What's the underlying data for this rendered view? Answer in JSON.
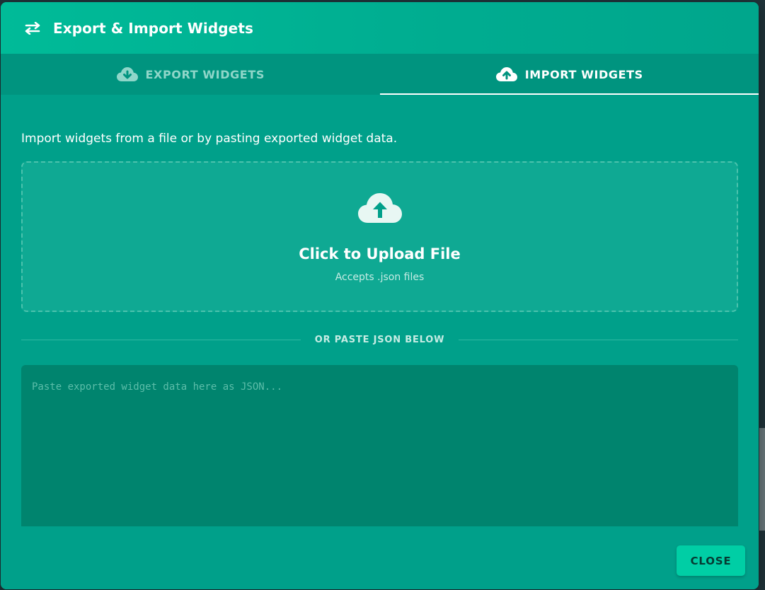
{
  "dialog": {
    "title": "Export & Import Widgets",
    "header_icon": "swap-arrows-icon"
  },
  "tabs": [
    {
      "label": "EXPORT WIDGETS",
      "icon": "cloud-download-icon",
      "active": false
    },
    {
      "label": "IMPORT WIDGETS",
      "icon": "cloud-upload-icon",
      "active": true
    }
  ],
  "import": {
    "intro": "Import widgets from a file or by pasting exported widget data.",
    "upload_title": "Click to Upload File",
    "upload_subtitle": "Accepts .json files",
    "divider_text": "OR PASTE JSON BELOW",
    "paste_placeholder": "Paste exported widget data here as JSON...",
    "paste_value": ""
  },
  "footer": {
    "close_label": "CLOSE"
  },
  "colors": {
    "dialog_bg": "#00a08a",
    "header_bg": "#00bb98",
    "tab_bar_bg": "#00947f",
    "textarea_bg": "#00846e",
    "close_button_bg": "#00cea5"
  }
}
